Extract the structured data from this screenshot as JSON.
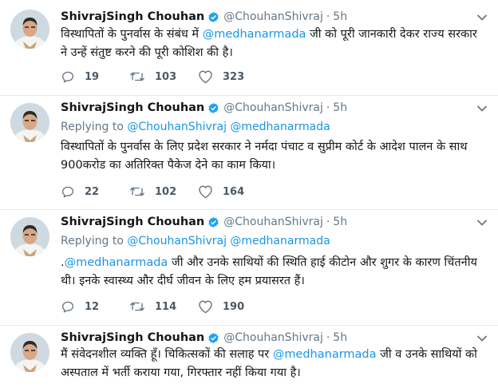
{
  "colors": {
    "link": "#1b95e0",
    "muted": "#657786",
    "verified": "#1da1f2",
    "divider": "#e6ecf0"
  },
  "icons": {
    "verified": "verified-badge-icon",
    "menu": "chevron-down-icon",
    "reply": "reply-icon",
    "retweet": "retweet-icon",
    "like": "heart-icon"
  },
  "tweets": [
    {
      "name": "ShivrajSingh Chouhan",
      "handle": "@ChouhanShivraj",
      "sep": "·",
      "time": "5h",
      "replying_prefix": "",
      "replying_to": [
        "",
        ""
      ],
      "text_before": "विस्थापितों के पुनर्वास के संबंध में ",
      "mention": "@medhanarmada",
      "text_after": " जी को पूरी जानकारी देकर राज्य सरकार ने उन्हें संतुष्ट करने की पूरी कोशिश की है।",
      "replies": "19",
      "retweets": "103",
      "likes": "323"
    },
    {
      "name": "ShivrajSingh Chouhan",
      "handle": "@ChouhanShivraj",
      "sep": "·",
      "time": "5h",
      "replying_prefix": "Replying to",
      "replying_to": [
        "@ChouhanShivraj",
        "@medhanarmada"
      ],
      "text_before": "विस्थापितों के पुनर्वास के लिए प्रदेश सरकार ने नर्मदा पंचाट व सुप्रीम कोर्ट के आदेश पालन के साथ 900करोड का अतिरिक्त पैकेज देने का काम किया।",
      "mention": "",
      "text_after": "",
      "replies": "22",
      "retweets": "102",
      "likes": "164"
    },
    {
      "name": "ShivrajSingh Chouhan",
      "handle": "@ChouhanShivraj",
      "sep": "·",
      "time": "5h",
      "replying_prefix": "Replying to",
      "replying_to": [
        "@ChouhanShivraj",
        "@medhanarmada"
      ],
      "text_before": ".",
      "mention": "@medhanarmada",
      "text_after": " जी और उनके साथियों की स्थिति हाई कीटोन और शुगर के कारण चिंतनीय थी। इनके स्वास्थ्य और दीर्घ जीवन के लिए हम प्रयासरत हैं।",
      "replies": "12",
      "retweets": "114",
      "likes": "190"
    },
    {
      "name": "ShivrajSingh Chouhan",
      "handle": "@ChouhanShivraj",
      "sep": "·",
      "time": "5h",
      "replying_prefix": "",
      "replying_to": [
        "",
        ""
      ],
      "text_before": "मैं संवेदनशील व्यक्ति हूँ। चिकित्सकों की सलाह पर ",
      "mention": "@medhanarmada",
      "text_after": " जी व उनके साथियों को अस्पताल में भर्ती कराया गया, गिरफ्तार नहीं किया गया है।",
      "replies": "",
      "retweets": "",
      "likes": ""
    }
  ]
}
